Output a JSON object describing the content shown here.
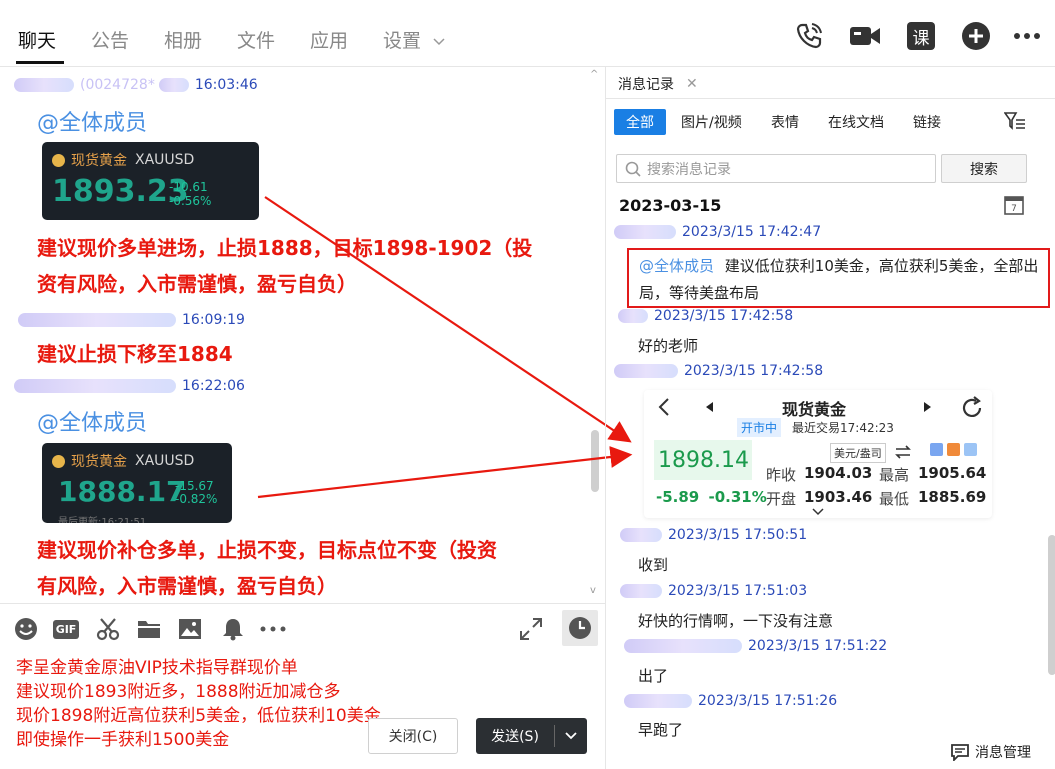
{
  "tabs": [
    "聊天",
    "公告",
    "相册",
    "文件",
    "应用",
    "设置"
  ],
  "top_icons": [
    "phone-icon",
    "video-camera-icon",
    "course-icon",
    "add-circle-icon",
    "more-icon"
  ],
  "course_label": "课",
  "chat": {
    "messages": [
      {
        "time": "16:03:46",
        "sender_partial": "(0024728*"
      },
      {
        "mention": "@全体成员"
      },
      {
        "card": {
          "name": "现货黄金",
          "symbol": "XAUUSD",
          "price": "1893.23",
          "change": "-10.61",
          "change_pct": "-0.56%"
        }
      },
      {
        "text": "建议现价多单进场，止损1888，目标1898-1902（投",
        "text2": "资有风险，入市需谨慎，盈亏自负）"
      },
      {
        "time": "16:09:19"
      },
      {
        "text": "建议止损下移至1884"
      },
      {
        "time": "16:22:06"
      },
      {
        "mention": "@全体成员"
      },
      {
        "card": {
          "name": "现货黄金",
          "symbol": "XAUUSD",
          "price": "1888.17",
          "change": "-15.67",
          "change_pct": "-0.82%",
          "footer": "最后更新:16:21:51"
        }
      },
      {
        "text": "建议现价补仓多单，止损不变，目标点位不变（投资",
        "text2": "有风险，入市需谨慎，盈亏自负）"
      }
    ]
  },
  "toolbar_icons": [
    "emoji-icon",
    "gif-icon",
    "scissors-icon",
    "folder-icon",
    "image-icon",
    "bell-icon",
    "more-icon",
    "expand-icon",
    "history-icon"
  ],
  "gif_label": "GIF",
  "compose": {
    "lines": [
      "李呈金黄金原油VIP技术指导群现价单",
      "建议现价1893附近多，1888附近加减仓多",
      "现价1898附近高位获利5美金，低位获利10美金",
      "即使操作一手获利1500美金"
    ]
  },
  "buttons": {
    "close": "关闭(C)",
    "send": "发送(S)"
  },
  "history": {
    "title": "消息记录",
    "filters": [
      "全部",
      "图片/视频",
      "表情",
      "在线文档",
      "链接"
    ],
    "search_placeholder": "搜索消息记录",
    "search_button": "搜索",
    "date": "2023-03-15",
    "calendar_day": "7",
    "records": [
      {
        "time": "2023/3/15 17:42:47",
        "mention": "@全体成员",
        "text": "建议低位获利10美金，高位获利5美金，全部出局，等待美盘布局"
      },
      {
        "time": "2023/3/15 17:42:58",
        "text": "好的老师"
      },
      {
        "time": "2023/3/15 17:42:58"
      },
      {
        "time": "2023/3/15 17:50:51",
        "text": "收到"
      },
      {
        "time": "2023/3/15 17:51:03",
        "text": "好快的行情啊，一下没有注意"
      },
      {
        "time": "2023/3/15 17:51:22",
        "text": "出了"
      },
      {
        "time": "2023/3/15 17:51:26",
        "text": "早跑了"
      }
    ],
    "quote": {
      "title": "现货黄金",
      "status": "开市中",
      "last_trade": "最近交易17:42:23",
      "price": "1898.14",
      "change": "-5.89",
      "change_pct": "-0.31%",
      "unit": "美元/盎司",
      "prev_close_label": "昨收",
      "prev_close": "1904.03",
      "open_label": "开盘",
      "open": "1903.46",
      "high_label": "最高",
      "high": "1905.64",
      "low_label": "最低",
      "low": "1885.69"
    },
    "manage": "消息管理"
  },
  "colors": {
    "accent": "#1a7fe4",
    "alert": "#e8190f",
    "up_green": "#1b9a4c",
    "card_bg": "#1b2128"
  }
}
